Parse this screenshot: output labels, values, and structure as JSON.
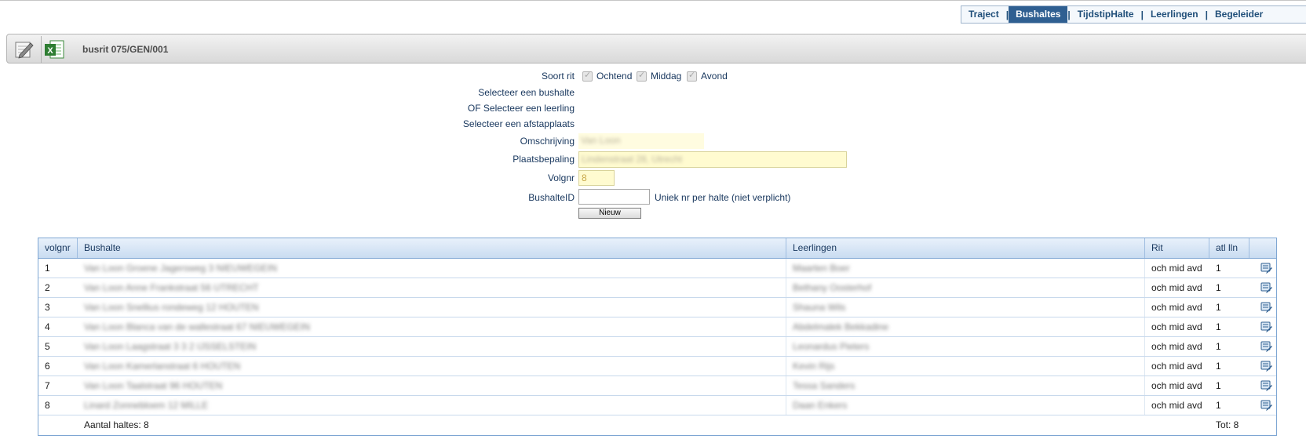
{
  "nav": {
    "items": [
      {
        "label": "Traject",
        "active": false
      },
      {
        "label": "Bushaltes",
        "active": true
      },
      {
        "label": "TijdstipHalte",
        "active": false
      },
      {
        "label": "Leerlingen",
        "active": false
      },
      {
        "label": "Begeleider",
        "active": false
      }
    ],
    "separator": "|"
  },
  "toolbar": {
    "title": "busrit 075/GEN/001",
    "icons": [
      "edit-icon",
      "excel-icon"
    ]
  },
  "form": {
    "soort_rit_label": "Soort rit",
    "checks": [
      {
        "label": "Ochtend",
        "checked": true
      },
      {
        "label": "Middag",
        "checked": true
      },
      {
        "label": "Avond",
        "checked": true
      }
    ],
    "select_bushalte_label": "Selecteer een bushalte",
    "select_leerling_label": "OF Selecteer een leerling",
    "select_afstapplaats_label": "Selecteer een afstapplaats",
    "omschrijving_label": "Omschrijving",
    "omschrijving_value": "Van Loon",
    "plaatsbepaling_label": "Plaatsbepaling",
    "plaatsbepaling_value": "Lindenstraat 28, Utrecht",
    "volgnr_label": "Volgnr",
    "volgnr_value": "8",
    "bushalteid_label": "BushalteID",
    "bushalteid_value": "",
    "bushalteid_hint": "Uniek nr per halte (niet verplicht)",
    "new_button": "Nieuw"
  },
  "table": {
    "headers": [
      "volgnr",
      "Bushalte",
      "Leerlingen",
      "Rit",
      "atl lln",
      ""
    ],
    "rows": [
      {
        "volgnr": "1",
        "bushalte": "Van Loon Groene Jagersweg 3 NIEUWEGEIN",
        "leerlingen": "Maarten Boer",
        "rit": "och mid avd",
        "aantal": "1"
      },
      {
        "volgnr": "2",
        "bushalte": "Van Loon Anne Frankstraat 56 UTRECHT",
        "leerlingen": "Bethany Oosterhof",
        "rit": "och mid avd",
        "aantal": "1"
      },
      {
        "volgnr": "3",
        "bushalte": "Van Loon Snellius rondeweg 12 HOUTEN",
        "leerlingen": "Shauna Wils",
        "rit": "och mid avd",
        "aantal": "1"
      },
      {
        "volgnr": "4",
        "bushalte": "Van Loon Blanca van de wallestraat 67 NIEUWEGEIN",
        "leerlingen": "Abdelmalek Bekkadine",
        "rit": "och mid avd",
        "aantal": "1"
      },
      {
        "volgnr": "5",
        "bushalte": "Van Loon Laagstraat 3 3 2 IJSSELSTEIN",
        "leerlingen": "Leonardus Pieters",
        "rit": "och mid avd",
        "aantal": "1"
      },
      {
        "volgnr": "6",
        "bushalte": "Van Loon Kamerlanstraat 6 HOUTEN",
        "leerlingen": "Kevin Rijs",
        "rit": "och mid avd",
        "aantal": "1"
      },
      {
        "volgnr": "7",
        "bushalte": "Van Loon Taalstraat 96 HOUTEN",
        "leerlingen": "Tessa Sanders",
        "rit": "och mid avd",
        "aantal": "1"
      },
      {
        "volgnr": "8",
        "bushalte": "Linard Zonnebloem 12 MILLE",
        "leerlingen": "Daan Enkers",
        "rit": "och mid avd",
        "aantal": "1"
      }
    ],
    "footer_count": "Aantal haltes: 8",
    "footer_total": "Tot: 8",
    "row_icon": "bus-stop-edit-icon"
  }
}
